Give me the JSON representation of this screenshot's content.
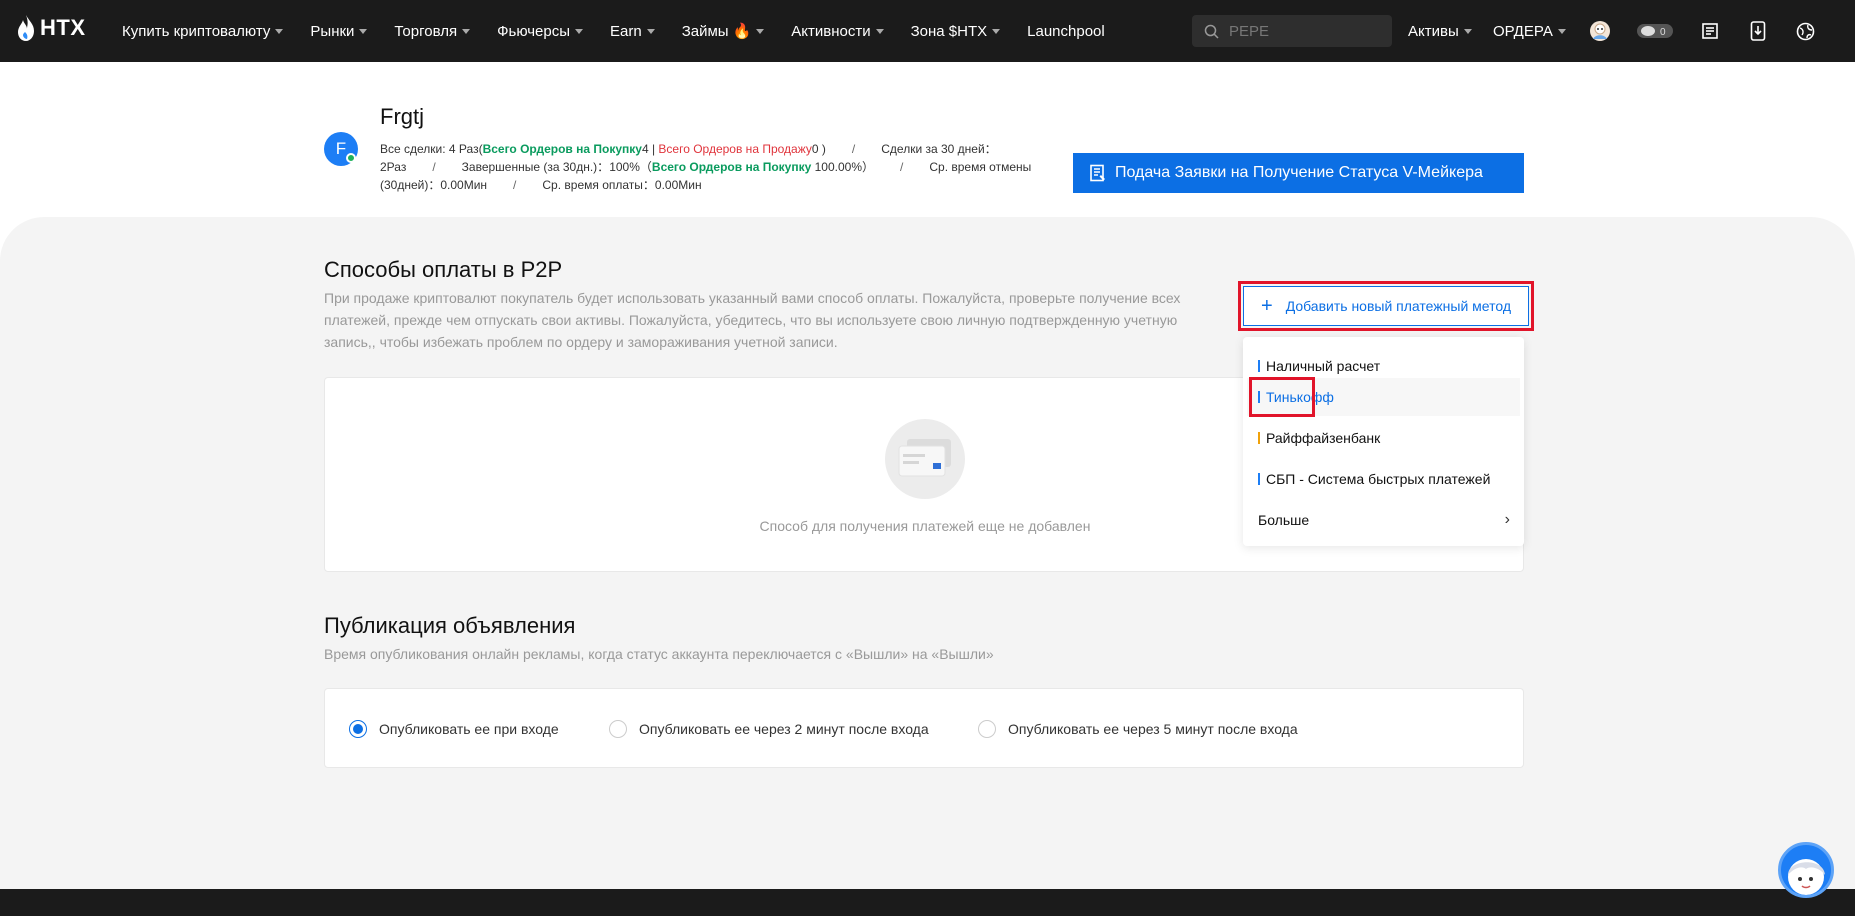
{
  "brand": {
    "name": "HTX",
    "accent": "#1d7ef5"
  },
  "nav": {
    "items": [
      {
        "label": "Купить криптовалюту",
        "caret": true
      },
      {
        "label": "Рынки",
        "caret": true
      },
      {
        "label": "Торговля",
        "caret": true
      },
      {
        "label": "Фьючерсы",
        "caret": true
      },
      {
        "label": "Earn",
        "caret": true
      },
      {
        "label": "Займы",
        "caret": true,
        "badge": "fire-icon"
      },
      {
        "label": "Активности",
        "caret": true
      },
      {
        "label": "Зона $HTX",
        "caret": true
      },
      {
        "label": "Launchpool",
        "caret": false
      }
    ],
    "search_placeholder": "PEPE",
    "assets_label": "Активы",
    "orders_label": "ОРДЕРА"
  },
  "profile": {
    "initial": "F",
    "username": "Frgtj",
    "all_trades_label": "Все сделки: 4 Раз(",
    "total_buy_label": "Всего Ордеров на Покупку",
    "total_buy_value": "4",
    "total_sell_label": "Всего Ордеров на Продажу",
    "total_sell_value": "0",
    "trades_30d_label": "Сделки за 30 дней：",
    "trades_30d_value": "2Раз",
    "completed_label": "Завершенные (за 30дн.)：",
    "completed_value": "100%",
    "completed_buy_label": "Всего Ордеров на Покупку",
    "completed_buy_value": "100.00%",
    "avg_cancel_label": "Ср. время отмены (30дней)：",
    "avg_cancel_value": "0.00Мин",
    "avg_pay_label": "Ср. время оплаты：",
    "avg_pay_value": "0.00Мин",
    "vmaker_button": "Подача Заявки на Получение Статуса V-Мейкера"
  },
  "payment": {
    "title": "Способы оплаты в P2P",
    "description": "При продаже криптовалют покупатель будет использовать указанный вами способ оплаты. Пожалуйста, проверьте получение всех платежей, прежде чем отпускать свои активы. Пожалуйста, убедитесь, что вы используете свою личную подтвержденную учетную запись,, чтобы избежать проблем по ордеру и замораживания учетной записи.",
    "add_button": "Добавить новый платежный метод",
    "empty_text": "Способ для получения платежей еще не добавлен",
    "dropdown": [
      {
        "label": "Наличный расчет",
        "color": "#1d7ef5"
      },
      {
        "label": "Тинькофф",
        "color": "#1d7ef5",
        "highlighted": true
      },
      {
        "label": "Райффайзенбанк",
        "color": "#f0a20b"
      },
      {
        "label": "СБП - Система быстрых платежей",
        "color": "#1d7ef5"
      }
    ],
    "more_label": "Больше"
  },
  "publication": {
    "title": "Публикация объявления",
    "description": "Время опубликования онлайн рекламы, когда статус аккаунта переключается с «Вышли» на «Вышли»",
    "options": [
      {
        "label": "Опубликовать ее при входе",
        "selected": true
      },
      {
        "label": "Опубликовать ее через 2 минут после входа",
        "selected": false
      },
      {
        "label": "Опубликовать ее через 5 минут после входа",
        "selected": false
      }
    ]
  }
}
